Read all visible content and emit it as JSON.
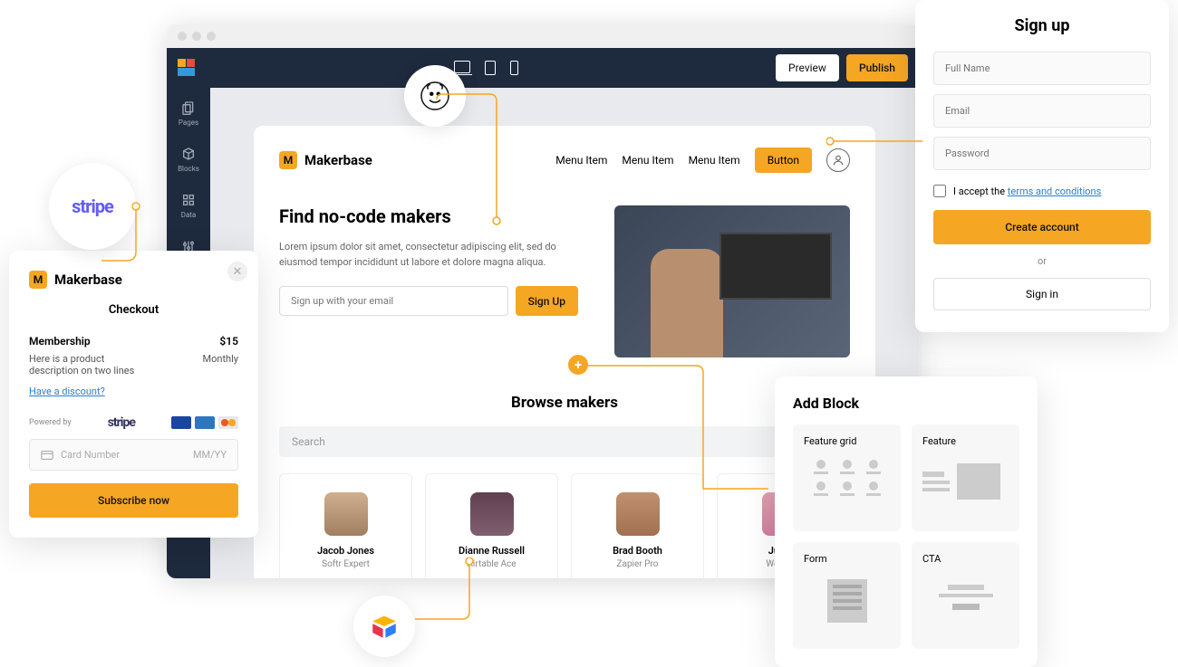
{
  "editor": {
    "preview": "Preview",
    "publish": "Publish",
    "sidebar": {
      "pages": "Pages",
      "blocks": "Blocks",
      "data": "Data",
      "settings": "Settings"
    }
  },
  "site": {
    "brand_letter": "M",
    "brand_name": "Makerbase",
    "nav": {
      "item1": "Menu Item",
      "item2": "Menu Item",
      "item3": "Menu Item",
      "button": "Button"
    },
    "hero": {
      "title": "Find no-code makers",
      "desc": "Lorem ipsum dolor sit amet, consectetur adipiscing elit, sed do eiusmod tempor incididunt ut labore et dolore magna aliqua.",
      "email_placeholder": "Sign up with your email",
      "signup_btn": "Sign Up"
    },
    "browse": {
      "title": "Browse makers",
      "search_placeholder": "Search",
      "makers": [
        {
          "name": "Jacob Jones",
          "role": "Softr Expert"
        },
        {
          "name": "Dianne Russell",
          "role": "Airtable Ace"
        },
        {
          "name": "Brad Booth",
          "role": "Zapier Pro"
        },
        {
          "name": "Julia R",
          "role": "Webflow"
        }
      ]
    }
  },
  "signup": {
    "title": "Sign up",
    "fullname": "Full Name",
    "email": "Email",
    "password": "Password",
    "accept": "I accept the ",
    "terms": "terms and conditions",
    "create": "Create account",
    "or": "or",
    "signin": "Sign in"
  },
  "checkout": {
    "brand_letter": "M",
    "brand_name": "Makerbase",
    "title": "Checkout",
    "item": "Membership",
    "price": "$15",
    "desc": "Here is a product description on two lines",
    "period": "Monthly",
    "discount": "Have a discount?",
    "powered": "Powered by",
    "card_number": "Card Number",
    "card_exp": "MM/YY",
    "subscribe": "Subscribe now"
  },
  "addblock": {
    "title": "Add Block",
    "tiles": {
      "t1": "Feature grid",
      "t2": "Feature",
      "t3": "Form",
      "t4": "CTA"
    }
  },
  "integrations": {
    "stripe": "stripe"
  }
}
